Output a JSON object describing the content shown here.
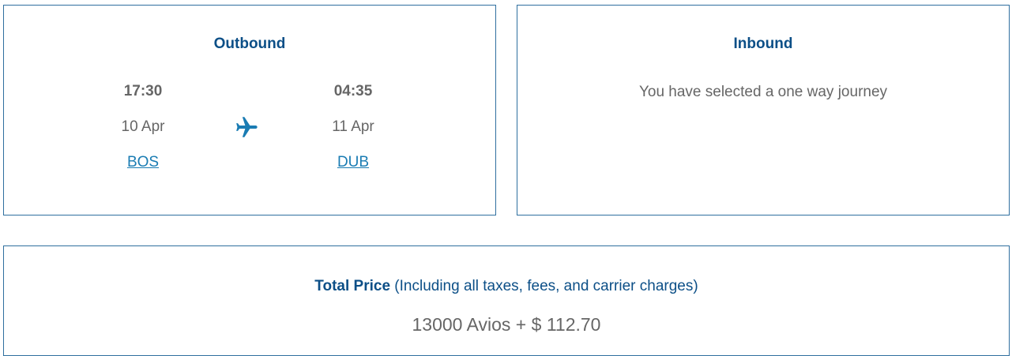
{
  "outbound": {
    "title": "Outbound",
    "departure": {
      "time": "17:30",
      "date": "10 Apr",
      "airport": "BOS"
    },
    "arrival": {
      "time": "04:35",
      "date": "11 Apr",
      "airport": "DUB"
    },
    "icon": "airplane-icon"
  },
  "inbound": {
    "title": "Inbound",
    "message": "You have selected a one way journey"
  },
  "price": {
    "label": "Total Price",
    "note": "(Including all taxes, fees, and carrier charges)",
    "amount": "13000 Avios + $ 112.70"
  },
  "colors": {
    "border": "#2f6f9f",
    "title": "#0c4f87",
    "link": "#1a7cb3",
    "text": "#666666"
  }
}
